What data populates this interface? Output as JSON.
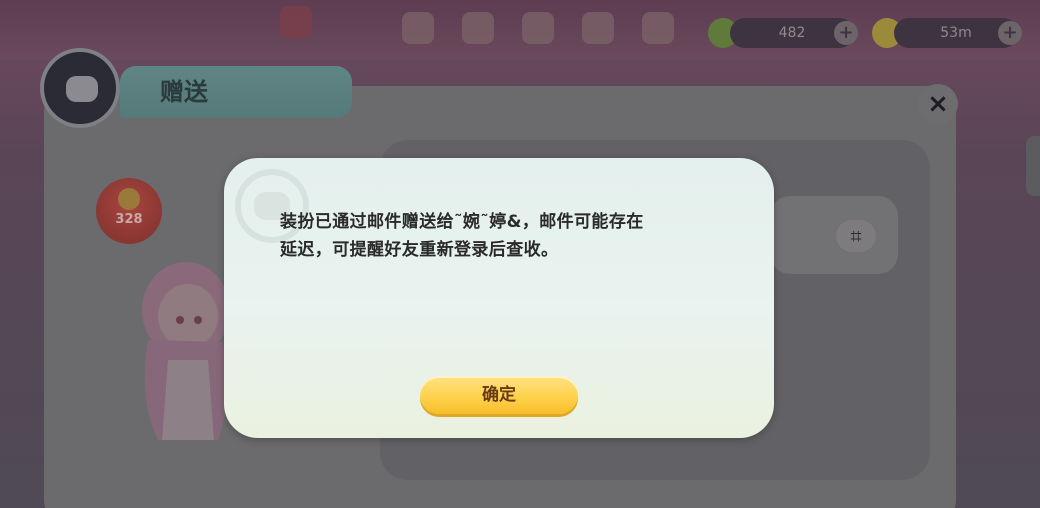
{
  "top_bar": {
    "resource_1": {
      "value": "482",
      "icon": "energy-icon"
    },
    "resource_2": {
      "value": "53m",
      "icon": "coin-icon"
    },
    "plus_label": "+"
  },
  "panel": {
    "title": "赠送",
    "close_label": "×",
    "price": "328",
    "gift_icon": "gift-icon"
  },
  "dialog": {
    "message": "装扮已通过邮件赠送给˜婉˜婷&，邮件可能存在\n延迟，可提醒好友重新登录后查收。",
    "confirm_label": "确定"
  },
  "colors": {
    "dialog_bg": "#e6f1ee",
    "confirm_button": "#ffd24c",
    "confirm_text": "#6a3a17",
    "panel_tab": "#5f8584"
  }
}
